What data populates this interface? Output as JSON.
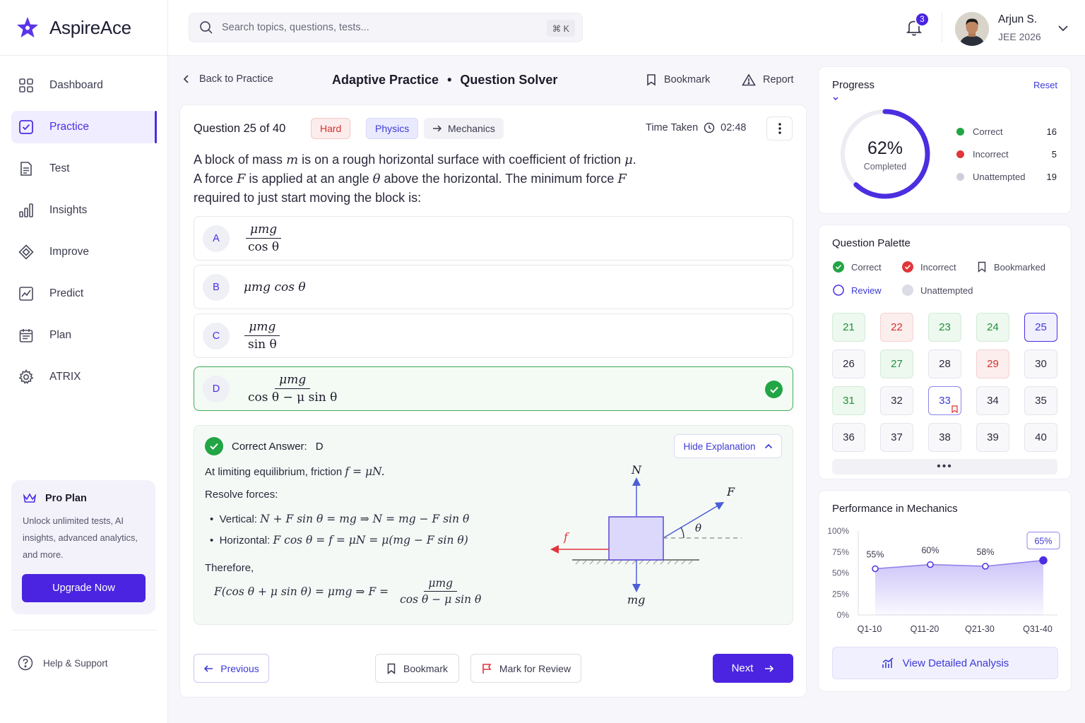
{
  "app": {
    "name": "AspireAce"
  },
  "sidebar": {
    "items": [
      {
        "label": "Dashboard",
        "icon": "grid-icon"
      },
      {
        "label": "Practice",
        "icon": "checkbox-icon",
        "active": true
      },
      {
        "label": "Test",
        "icon": "document-icon"
      },
      {
        "label": "Insights",
        "icon": "bar-chart-icon"
      },
      {
        "label": "Improve",
        "icon": "diamond-icon"
      },
      {
        "label": "Predict",
        "icon": "trend-icon"
      },
      {
        "label": "Plan",
        "icon": "calendar-icon"
      },
      {
        "label": "ATRIX",
        "icon": "gear-icon"
      }
    ],
    "pro": {
      "title": "Pro Plan",
      "desc": "Unlock unlimited tests, AI insights, advanced analytics, and more.",
      "cta": "Upgrade Now"
    },
    "help": "Help & Support"
  },
  "header": {
    "search_placeholder": "Search topics, questions, tests...",
    "shortcut": "⌘  K",
    "notifications": "3",
    "user": {
      "name": "Arjun S.",
      "sub": "JEE 2026"
    }
  },
  "subheader": {
    "back": "Back to Practice",
    "title_left": "Adaptive Practice",
    "separator": "•",
    "title_right": "Question Solver",
    "bookmark": "Bookmark",
    "report": "Report"
  },
  "question": {
    "number": "Question 25 of 40",
    "difficulty": "Hard",
    "subject": "Physics",
    "topic": "Mechanics",
    "time_label": "Time Taken",
    "time_value": "02:48",
    "text_1a": "A block of mass ",
    "text_1b": "m",
    "text_1c": " is on a rough horizontal surface with coefficient of friction ",
    "text_1d": "μ",
    "text_1e": ".",
    "text_2a": "A force ",
    "text_2b": "F",
    "text_2c": " is applied at an angle ",
    "text_2d": "θ",
    "text_2e": " above the horizontal. The minimum force ",
    "text_2f": "F",
    "text_3": "required to just start moving the block is:",
    "options": [
      {
        "letter": "A",
        "num": "μmg",
        "den": "cos θ"
      },
      {
        "letter": "B",
        "expr": "μmg cos θ"
      },
      {
        "letter": "C",
        "num": "μmg",
        "den": "sin θ"
      },
      {
        "letter": "D",
        "num": "μmg",
        "den": "cos θ − μ sin θ",
        "correct": true
      }
    ]
  },
  "explanation": {
    "correct_label": "Correct Answer:",
    "correct_value": "D",
    "hide": "Hide Explanation",
    "line1_a": "At limiting equilibrium, friction ",
    "line1_b": "f = μN.",
    "line2": "Resolve forces:",
    "vert_label": "Vertical:",
    "vert_expr": "N + F sin θ = mg ⇒ N = mg − F sin θ",
    "horiz_label": "Horizontal:",
    "horiz_expr": "F cos θ = f = μN = μ(mg − F sin θ)",
    "therefore": "Therefore,",
    "final_lhs": "F(cos θ + μ sin θ) = μmg ⇒ F =",
    "final_num": "μmg",
    "final_den": "cos θ − μ sin θ",
    "diagram": {
      "N": "N",
      "F": "F",
      "theta": "θ",
      "f": "f",
      "mg": "mg"
    }
  },
  "footer": {
    "previous": "Previous",
    "bookmark": "Bookmark",
    "review": "Mark for Review",
    "next": "Next"
  },
  "progress": {
    "title": "Progress",
    "reset": "Reset",
    "percent": "62%",
    "percent_value": 62,
    "completed": "Completed",
    "legend": [
      {
        "label": "Correct",
        "value": "16",
        "color": "#22a545"
      },
      {
        "label": "Incorrect",
        "value": "5",
        "color": "#e0353a"
      },
      {
        "label": "Unattempted",
        "value": "19",
        "color": "#cfcfdc"
      }
    ]
  },
  "palette": {
    "title": "Question Palette",
    "legend": {
      "correct": "Correct",
      "incorrect": "Incorrect",
      "bookmarked": "Bookmarked",
      "review": "Review",
      "unattempted": "Unattempted"
    },
    "more": "•••",
    "questions": [
      {
        "n": "21",
        "s": "correct"
      },
      {
        "n": "22",
        "s": "incorrect"
      },
      {
        "n": "23",
        "s": "correct"
      },
      {
        "n": "24",
        "s": "correct"
      },
      {
        "n": "25",
        "s": "current"
      },
      {
        "n": "26",
        "s": "none"
      },
      {
        "n": "27",
        "s": "correct"
      },
      {
        "n": "28",
        "s": "none"
      },
      {
        "n": "29",
        "s": "incorrect"
      },
      {
        "n": "30",
        "s": "none"
      },
      {
        "n": "31",
        "s": "correct"
      },
      {
        "n": "32",
        "s": "none"
      },
      {
        "n": "33",
        "s": "review",
        "bookmarked": true
      },
      {
        "n": "34",
        "s": "none"
      },
      {
        "n": "35",
        "s": "none"
      },
      {
        "n": "36",
        "s": "none"
      },
      {
        "n": "37",
        "s": "none"
      },
      {
        "n": "38",
        "s": "none"
      },
      {
        "n": "39",
        "s": "none"
      },
      {
        "n": "40",
        "s": "none"
      }
    ]
  },
  "performance": {
    "title": "Performance in Mechanics",
    "cta": "View Detailed Analysis"
  },
  "chart_data": {
    "type": "area",
    "categories": [
      "Q1-10",
      "Q11-20",
      "Q21-30",
      "Q31-40"
    ],
    "values": [
      55,
      60,
      58,
      65
    ],
    "data_labels": [
      "55%",
      "60%",
      "58%",
      "65%"
    ],
    "yticks": [
      "100%",
      "75%",
      "50%",
      "25%",
      "0%"
    ],
    "ylim": [
      0,
      100
    ],
    "highlight_last": true,
    "color": "#4c2ee0"
  }
}
